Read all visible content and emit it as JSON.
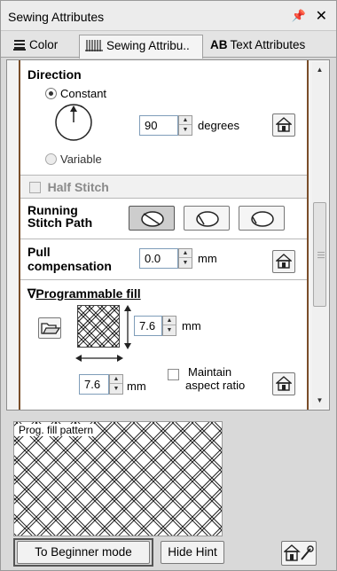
{
  "panel": {
    "title": "Sewing Attributes",
    "pin_icon": "pin-icon",
    "close_icon": "close-icon"
  },
  "tabs": [
    {
      "label": "Color",
      "icon": "color-palette-icon",
      "active": false
    },
    {
      "label": "Sewing Attribu..",
      "icon": "sewing-pattern-icon",
      "active": true
    },
    {
      "label": "Text Attributes",
      "icon_text": "AB",
      "active": false
    }
  ],
  "direction": {
    "heading": "Direction",
    "constant_label": "Constant",
    "variable_label": "Variable",
    "selected": "Constant",
    "angle_value": "90",
    "angle_unit": "degrees"
  },
  "half_stitch": {
    "label": "Half Stitch",
    "checked": false
  },
  "running_stitch_path": {
    "label_line1": "Running",
    "label_line2": "Stitch Path",
    "selected_index": 0
  },
  "pull_compensation": {
    "label_line1": "Pull",
    "label_line2": "compensation",
    "value": "0.0",
    "unit": "mm"
  },
  "programmable_fill": {
    "heading_arrow": "∇",
    "heading": "Programmable fill",
    "height_value": "7.6",
    "height_unit": "mm",
    "width_value": "7.6",
    "width_unit": "mm",
    "maintain_line1": "Maintain",
    "maintain_line2": "aspect ratio",
    "maintain_checked": false
  },
  "preview": {
    "caption": "Prog. fill pattern"
  },
  "footer": {
    "beginner_button": "To Beginner mode",
    "hide_hint_button": "Hide Hint",
    "settings_icon": "home-settings-icon"
  },
  "colors": {
    "section_border": "#7a4e2a",
    "selected_button": "#cdcdcd"
  }
}
